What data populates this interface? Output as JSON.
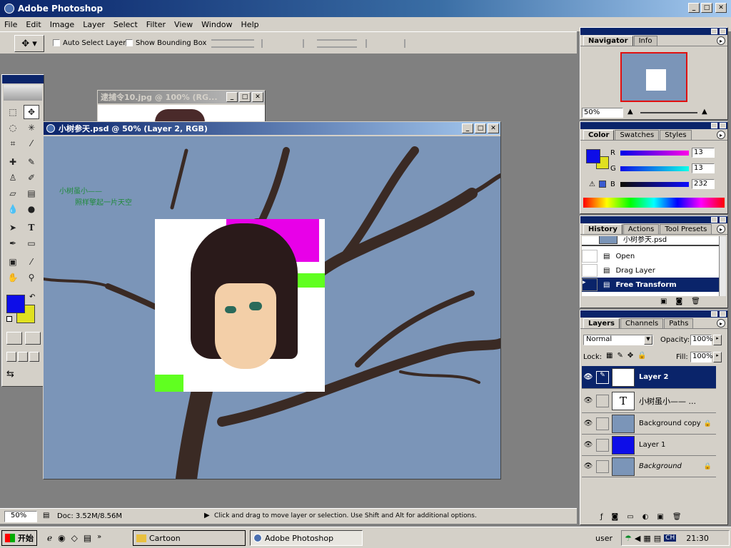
{
  "app": {
    "title": "Adobe Photoshop"
  },
  "menu": [
    "File",
    "Edit",
    "Image",
    "Layer",
    "Select",
    "Filter",
    "View",
    "Window",
    "Help"
  ],
  "options": {
    "auto_select": "Auto Select Layer",
    "bounding_box": "Show Bounding Box"
  },
  "doc_back": {
    "title": "逮捕令10.jpg @ 100% (RG..."
  },
  "doc_main": {
    "title": "小树参天.psd @ 50% (Layer 2, RGB)",
    "caption1": "小树虽小——",
    "caption2": "照样擎起一片天空"
  },
  "navigator": {
    "tabs": [
      "Navigator",
      "Info"
    ],
    "zoom": "50%"
  },
  "color": {
    "tabs": [
      "Color",
      "Swatches",
      "Styles"
    ],
    "r_label": "R",
    "g_label": "G",
    "b_label": "B",
    "r": "13",
    "g": "13",
    "b": "232",
    "fg": "#0d0de8",
    "bg": "#e0e020"
  },
  "history": {
    "tabs": [
      "History",
      "Actions",
      "Tool Presets"
    ],
    "top_item": "小树参天.psd",
    "items": [
      "Open",
      "Drag Layer",
      "Free Transform"
    ]
  },
  "layers": {
    "tabs": [
      "Layers",
      "Channels",
      "Paths"
    ],
    "mode": "Normal",
    "opacity_label": "Opacity:",
    "opacity": "100%",
    "lock_label": "Lock:",
    "fill_label": "Fill:",
    "fill": "100%",
    "items": [
      "Layer 2",
      "小树虽小—— ...",
      "Background copy",
      "Layer 1",
      "Background"
    ]
  },
  "status": {
    "zoom": "50%",
    "doc": "Doc: 3.52M/8.56M",
    "hint": "Click and drag to move layer or selection.  Use Shift and Alt for additional options."
  },
  "taskbar": {
    "start": "开始",
    "tasks": [
      "Cartoon",
      "Adobe Photoshop"
    ],
    "user": "user",
    "ime": "CH",
    "time": "21:30"
  },
  "colors": {
    "accent": "#0a246a",
    "chrome": "#d4d0c8",
    "sky": "#7b95b8"
  }
}
